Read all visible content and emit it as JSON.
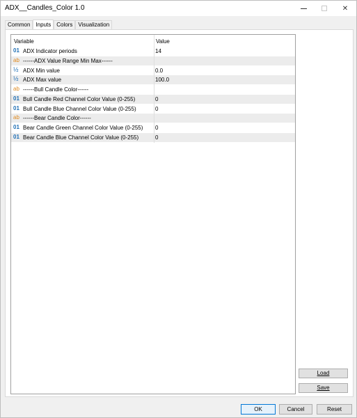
{
  "window": {
    "title": "ADX__Candles_Color 1.0",
    "controls": {
      "minimize": "minimize",
      "maximize": "maximize",
      "close": "✕"
    }
  },
  "tabs": [
    {
      "label": "Common",
      "active": false
    },
    {
      "label": "Inputs",
      "active": true
    },
    {
      "label": "Colors",
      "active": false
    },
    {
      "label": "Visualization",
      "active": false
    }
  ],
  "grid": {
    "headers": {
      "variable": "Variable",
      "value": "Value"
    },
    "rows": [
      {
        "icon": "01",
        "icon_type": "int",
        "variable": "ADX Indicator periods",
        "value": "14"
      },
      {
        "icon": "ab",
        "icon_type": "string",
        "variable": "------ADX Value Range Min Max------",
        "value": ""
      },
      {
        "icon": "½",
        "icon_type": "double",
        "variable": "ADX Min value",
        "value": "0.0"
      },
      {
        "icon": "½",
        "icon_type": "double",
        "variable": "ADX Max value",
        "value": "100.0"
      },
      {
        "icon": "ab",
        "icon_type": "string",
        "variable": "------Bull Candle Color------",
        "value": ""
      },
      {
        "icon": "01",
        "icon_type": "int",
        "variable": "Bull Candle Red Channel Color Value (0-255)",
        "value": "0"
      },
      {
        "icon": "01",
        "icon_type": "int",
        "variable": "Bull Candle Blue Channel Color Value (0-255)",
        "value": "0"
      },
      {
        "icon": "ab",
        "icon_type": "string",
        "variable": "------Bear Candle Color------",
        "value": ""
      },
      {
        "icon": "01",
        "icon_type": "int",
        "variable": "Bear Candle Green Channel Color Value (0-255)",
        "value": "0"
      },
      {
        "icon": "01",
        "icon_type": "int",
        "variable": "Bear Candle Blue Channel Color Value (0-255)",
        "value": "0"
      }
    ]
  },
  "side_buttons": {
    "load": "Load",
    "save": "Save"
  },
  "footer": {
    "ok": "OK",
    "cancel": "Cancel",
    "reset": "Reset"
  },
  "colors": {
    "int_icon": "#1f6fb5",
    "string_icon": "#e08a1e",
    "ok_border": "#0078d7"
  }
}
